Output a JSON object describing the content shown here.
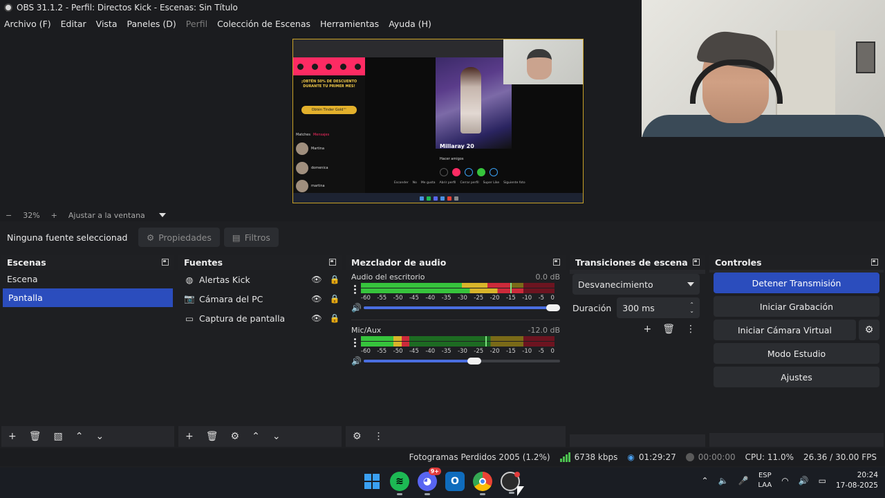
{
  "window": {
    "title": "OBS 31.1.2 - Perfil: Directos Kick - Escenas: Sin Título"
  },
  "menu": [
    {
      "label": "Archivo (F)",
      "enabled": true
    },
    {
      "label": "Editar",
      "enabled": true
    },
    {
      "label": "Vista",
      "enabled": true
    },
    {
      "label": "Paneles (D)",
      "enabled": true
    },
    {
      "label": "Perfil",
      "enabled": false
    },
    {
      "label": "Colección de Escenas",
      "enabled": true
    },
    {
      "label": "Herramientas",
      "enabled": true
    },
    {
      "label": "Ayuda (H)",
      "enabled": true
    }
  ],
  "preview": {
    "promo_text": "¡OBTÉN 50% DE DESCUENTO DURANTE TU PRIMER MES!",
    "gold_button": "Obtén Tinder Gold™",
    "tabs": [
      "Matches",
      "Mensajes"
    ],
    "matches": [
      "Martina",
      "domenica",
      "martina"
    ],
    "profile_name": "Millaray 20",
    "profile_sub": "Hacer amigos",
    "bottom_bar": [
      "Esconder",
      "No",
      "Me gusta",
      "Abrir perfil",
      "Cerrar perfil",
      "Super Like",
      "Siguiente foto"
    ]
  },
  "zoom": {
    "value": "32%",
    "fit_label": "Ajustar a la ventana"
  },
  "context": {
    "no_source": "Ninguna fuente seleccionad",
    "properties": "Propiedades",
    "filters": "Filtros"
  },
  "scenes": {
    "title": "Escenas",
    "items": [
      {
        "label": "Escena",
        "selected": false
      },
      {
        "label": "Pantalla",
        "selected": true
      }
    ]
  },
  "sources": {
    "title": "Fuentes",
    "items": [
      {
        "label": "Alertas Kick",
        "icon": "browser-icon"
      },
      {
        "label": "Cámara del PC",
        "icon": "camera-icon"
      },
      {
        "label": "Captura de pantalla",
        "icon": "monitor-icon"
      }
    ]
  },
  "mixer": {
    "title": "Mezclador de audio",
    "scale": [
      "-60",
      "-55",
      "-50",
      "-45",
      "-40",
      "-35",
      "-30",
      "-25",
      "-20",
      "-15",
      "-10",
      "-5",
      "0"
    ],
    "channels": [
      {
        "name": "Audio del escritorio",
        "db": "0.0 dB",
        "level1": 0.78,
        "level2": 0.84,
        "volume": 1.0
      },
      {
        "name": "Mic/Aux",
        "db": "-12.0 dB",
        "level1": 0.25,
        "level2": 0.65,
        "volume": 0.6
      }
    ]
  },
  "transitions": {
    "title": "Transiciones de escena",
    "selected": "Desvanecimiento",
    "duration_label": "Duración",
    "duration_value": "300 ms"
  },
  "controls": {
    "title": "Controles",
    "stop_stream": "Detener Transmisión",
    "start_recording": "Iniciar Grabación",
    "start_virtual_cam": "Iniciar Cámara Virtual",
    "studio_mode": "Modo Estudio",
    "settings": "Ajustes"
  },
  "status": {
    "dropped_frames": "Fotogramas Perdidos 2005 (1.2%)",
    "bitrate": "6738 kbps",
    "stream_time": "01:29:27",
    "rec_time": "00:00:00",
    "cpu": "CPU: 11.0%",
    "fps": "26.36 / 30.00 FPS"
  },
  "taskbar": {
    "discord_badge": "9+",
    "lang_top": "ESP",
    "lang_bottom": "LAA",
    "time": "20:24",
    "date": "17-08-2025"
  },
  "colors": {
    "accent": "#2b4dbd",
    "meter_green": "#36c43c",
    "meter_yellow": "#d9b52a",
    "meter_red": "#cc2a3a"
  }
}
